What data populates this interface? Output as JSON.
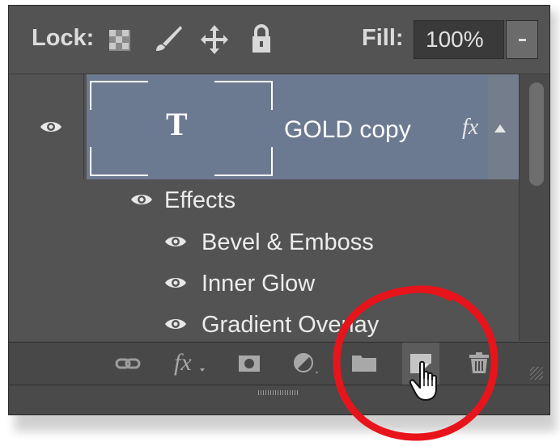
{
  "lock_bar": {
    "lock_label": "Lock:",
    "lock_icons": [
      "lock-transparent-pixels-icon",
      "lock-image-pixels-icon",
      "lock-position-icon",
      "lock-all-icon"
    ],
    "fill_label": "Fill:",
    "fill_value": "100%",
    "fill_dropdown_icon": "chevron-down-icon"
  },
  "layer": {
    "name": "GOLD copy",
    "thumbnail_glyph": "T",
    "fx_badge": "fx",
    "visible": true,
    "selected": true
  },
  "effects": {
    "label": "Effects",
    "items": [
      {
        "label": "Bevel & Emboss"
      },
      {
        "label": "Inner Glow"
      },
      {
        "label": "Gradient Overlay"
      }
    ]
  },
  "toolbar": {
    "buttons": [
      {
        "icon": "link-layers-icon"
      },
      {
        "icon": "fx-icon",
        "text": "fx"
      },
      {
        "icon": "layer-mask-icon"
      },
      {
        "icon": "adjustment-layer-icon"
      },
      {
        "icon": "folder-icon"
      },
      {
        "icon": "new-layer-icon",
        "highlighted": true
      },
      {
        "icon": "trash-icon"
      }
    ]
  },
  "colors": {
    "panel_bg": "#535353",
    "selected_row": "#6c7a91",
    "highlight_ring": "#e8141c",
    "text": "#ececec"
  }
}
